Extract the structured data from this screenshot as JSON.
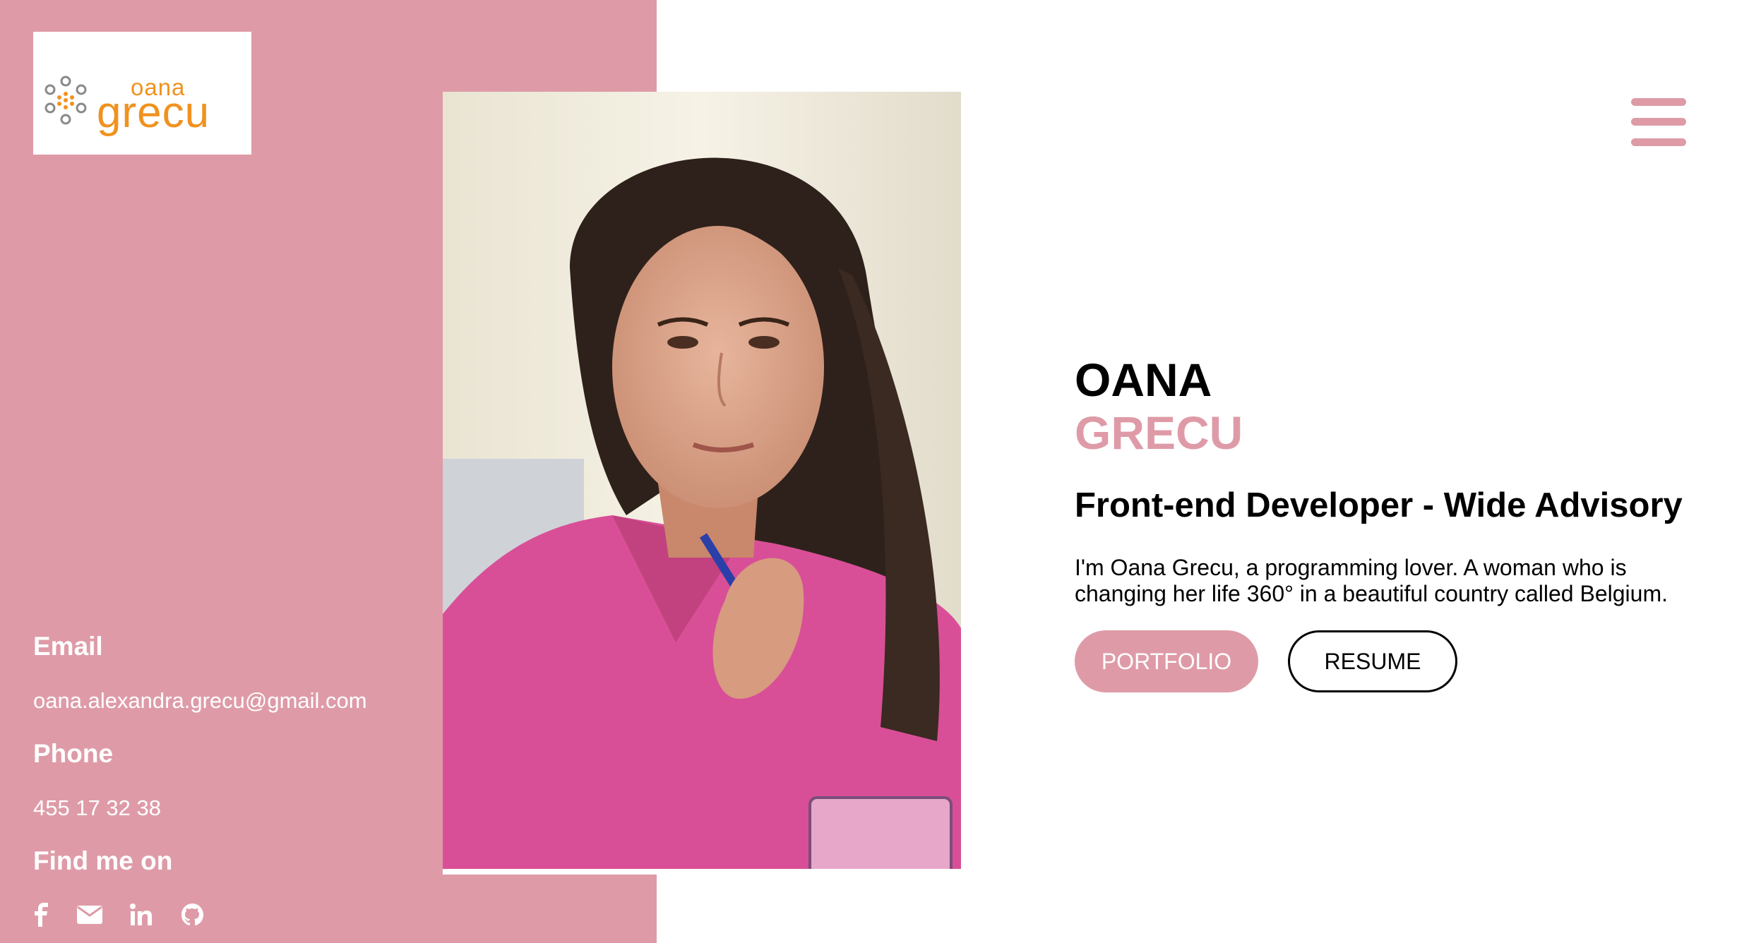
{
  "logo": {
    "top_text": "oana",
    "bottom_text": "grecu",
    "accent": "#f0921e"
  },
  "sidebar": {
    "bg_color": "#de9ba7",
    "email_heading": "Email",
    "email_value": "oana.alexandra.grecu@gmail.com",
    "phone_heading": "Phone",
    "phone_value": "455 17 32 38",
    "social_heading": "Find me on",
    "social_icons": [
      "facebook-icon",
      "envelope-icon",
      "linkedin-icon",
      "github-icon"
    ]
  },
  "profile": {
    "first_name": "OANA",
    "last_name": "GRECU",
    "role": "Front-end Developer - Wide Advisory",
    "bio": "I'm Oana Grecu, a programming lover. A woman who is changing her life 360° in a beautiful country called Belgium."
  },
  "buttons": {
    "portfolio": "PORTFOLIO",
    "resume": "RESUME"
  },
  "menu": {
    "icon": "hamburger-menu-icon"
  }
}
